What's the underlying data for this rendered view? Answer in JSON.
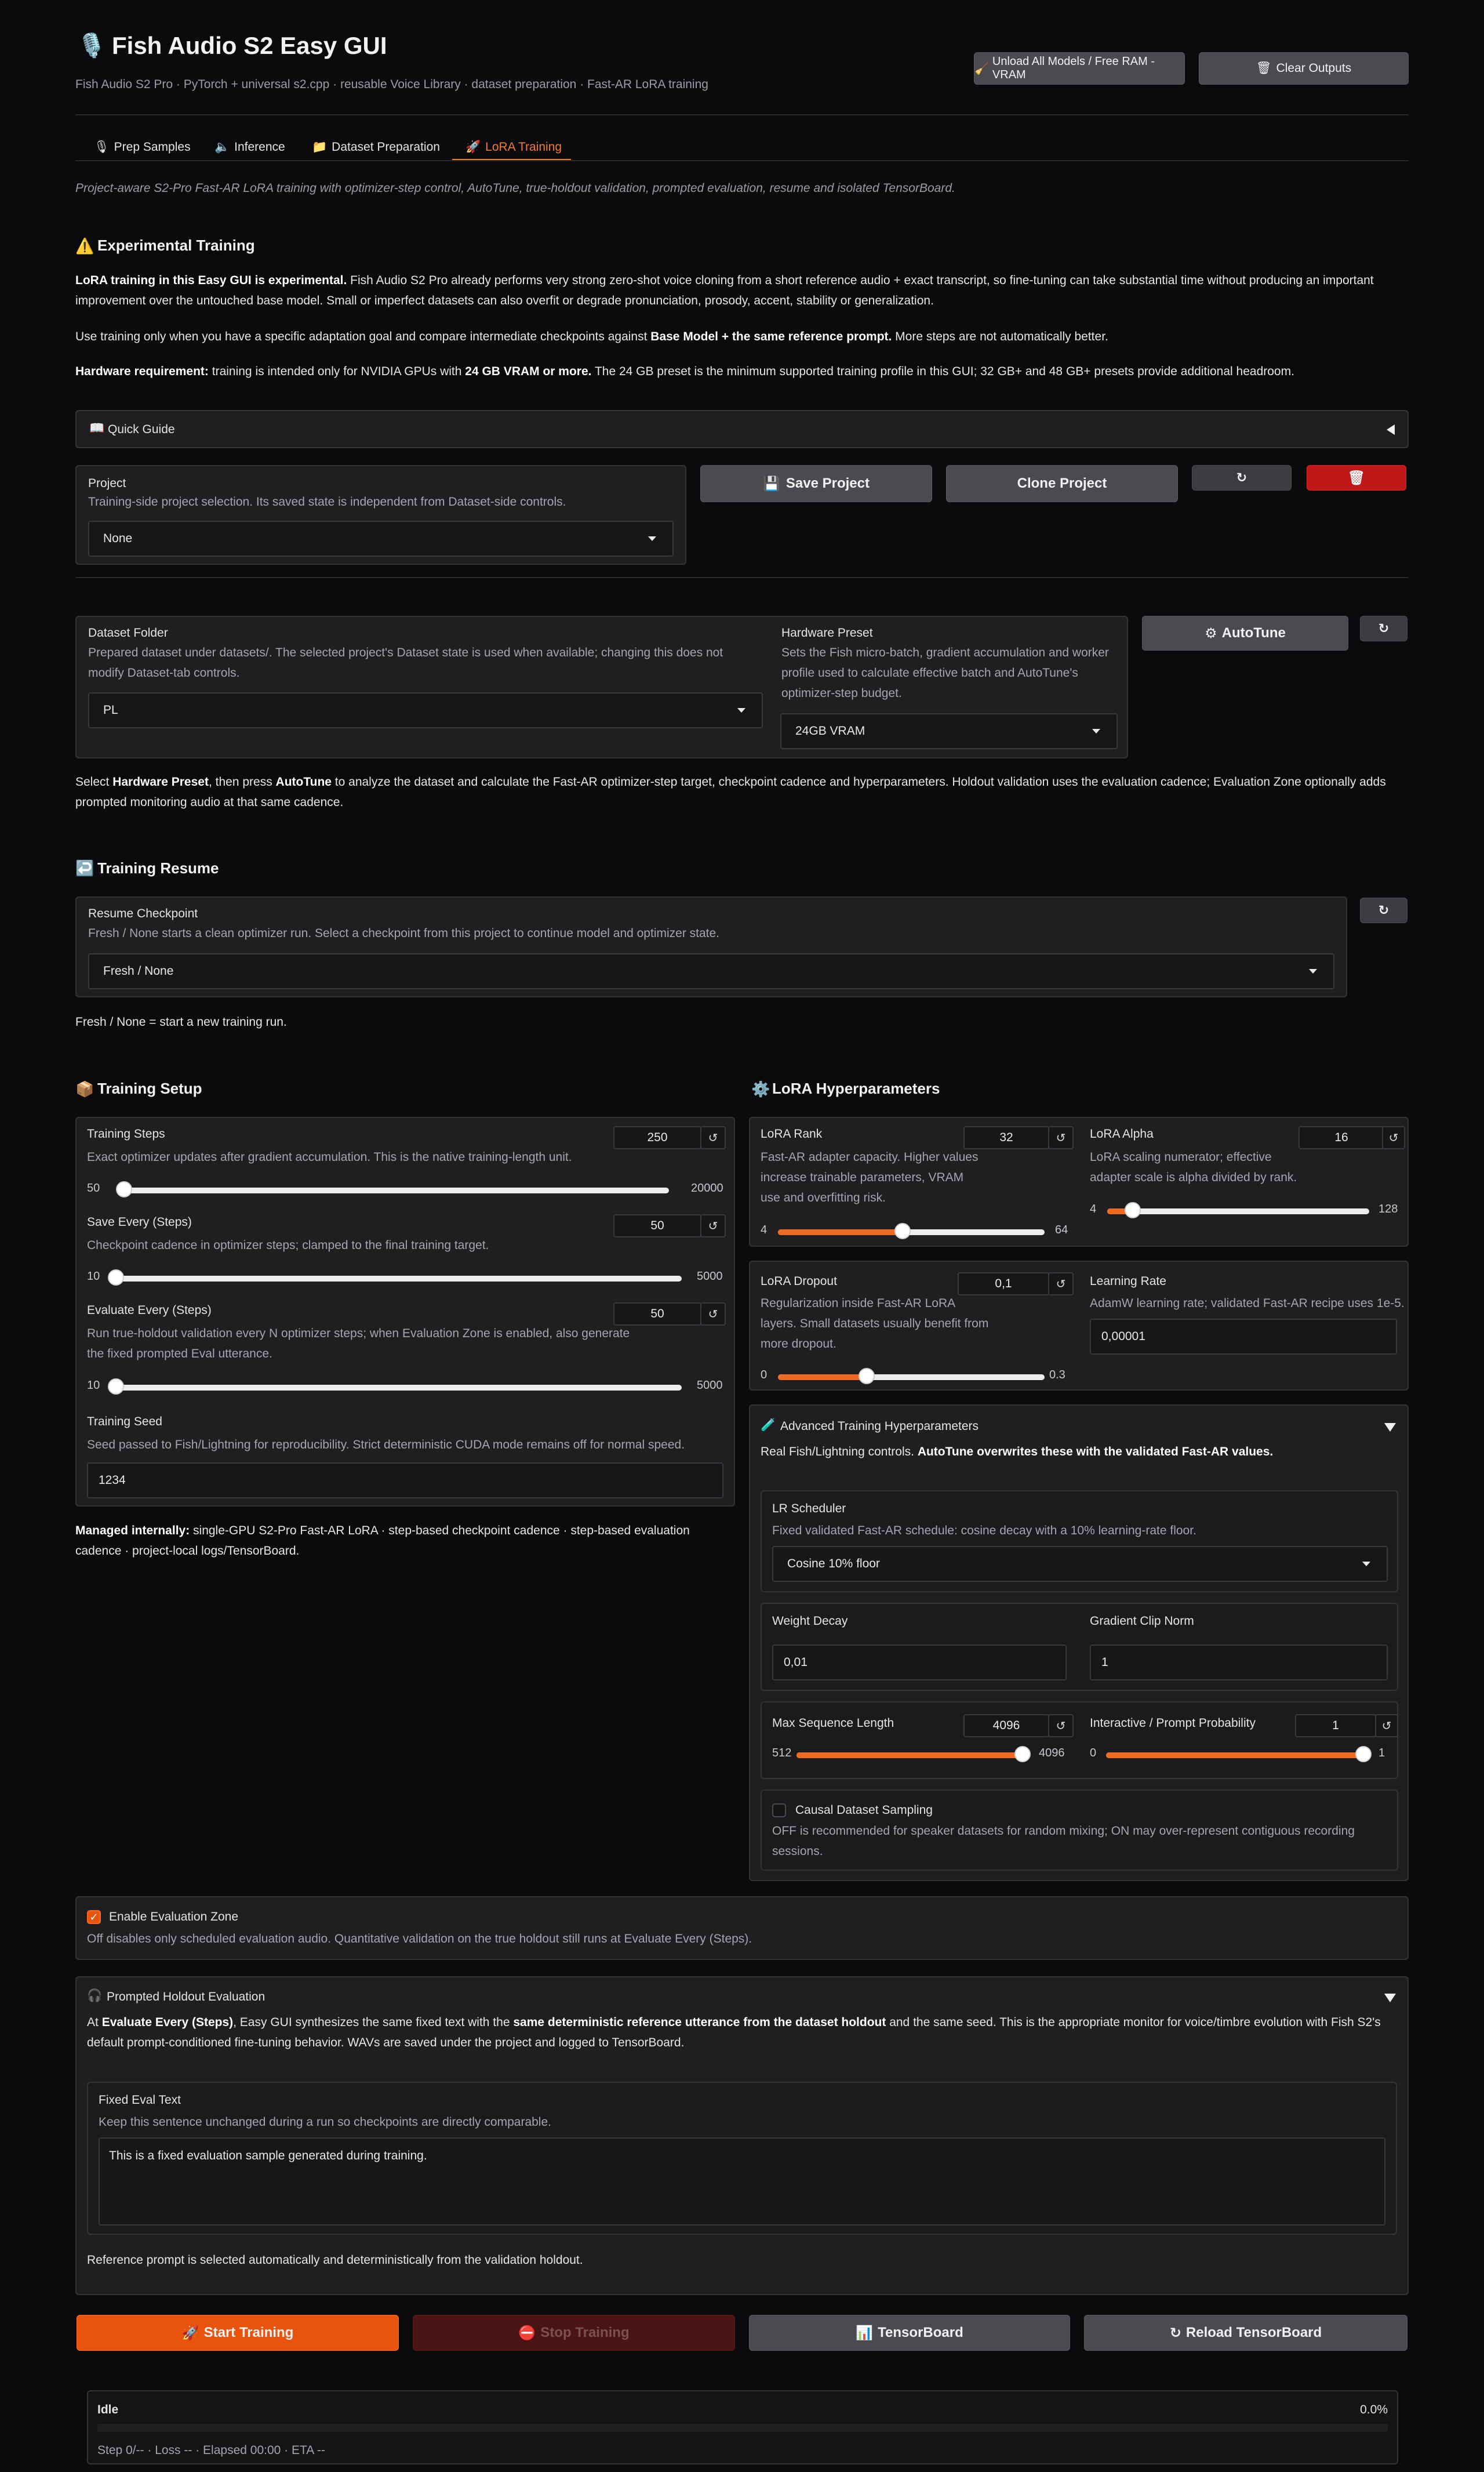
{
  "header": {
    "title": "Fish Audio S2 Easy GUI",
    "subtitle": "Fish Audio S2 Pro · PyTorch + universal s2.cpp · reusable Voice Library · dataset preparation · Fast-AR LoRA training",
    "unload_button": "Unload All Models / Free RAM - VRAM",
    "clear_button": "Clear Outputs"
  },
  "tabs": [
    {
      "label": "Prep Samples",
      "icon": "microphone-icon"
    },
    {
      "label": "Inference",
      "icon": "speaker-icon"
    },
    {
      "label": "Dataset Preparation",
      "icon": "folder-icon"
    },
    {
      "label": "LoRA Training",
      "icon": "rocket-icon",
      "active": true
    }
  ],
  "intro": "Project-aware S2-Pro Fast-AR LoRA training with optimizer-step control, AutoTune, true-holdout validation, prompted evaluation, resume and isolated TensorBoard.",
  "experimental": {
    "title": "Experimental Training",
    "p1_bold": "LoRA training in this Easy GUI is experimental.",
    "p1_rest": " Fish Audio S2 Pro already performs very strong zero-shot voice cloning from a short reference audio + exact transcript, so fine-tuning can take substantial time without producing an important improvement over the untouched base model. Small or imperfect datasets can also overfit or degrade pronunciation, prosody, accent, stability or generalization.",
    "p2_a": "Use training only when you have a specific adaptation goal and compare intermediate checkpoints against ",
    "p2_bold": "Base Model + the same reference prompt.",
    "p2_b": " More steps are not automatically better.",
    "p3_bold1": "Hardware requirement:",
    "p3_a": " training is intended only for NVIDIA GPUs with ",
    "p3_bold2": "24 GB VRAM or more.",
    "p3_b": " The 24 GB preset is the minimum supported training profile in this GUI; 32 GB+ and 48 GB+ presets provide additional headroom."
  },
  "quick_guide": {
    "label": "Quick Guide"
  },
  "project": {
    "label": "Project",
    "desc": "Training-side project selection. Its saved state is independent from Dataset-side controls.",
    "value": "None",
    "save_button": "Save Project",
    "clone_button": "Clone Project",
    "refresh_icon": "↻",
    "delete_icon": "trash-icon"
  },
  "dataset_folder": {
    "label": "Dataset Folder",
    "desc": "Prepared dataset under datasets/. The selected project's Dataset state is used when available; changing this does not modify Dataset-tab controls.",
    "value": "PL"
  },
  "hardware_preset": {
    "label": "Hardware Preset",
    "desc": "Sets the Fish micro-batch, gradient accumulation and worker profile used to calculate effective batch and AutoTune's optimizer-step budget.",
    "value": "24GB VRAM"
  },
  "autotune": {
    "label": "AutoTune",
    "refresh": "↻"
  },
  "autotune_note": {
    "a": "Select ",
    "b1": "Hardware Preset",
    "c": ", then press ",
    "b2": "AutoTune",
    "d": " to analyze the dataset and calculate the Fast-AR optimizer-step target, checkpoint cadence and hyperparameters. Holdout validation uses the evaluation cadence; Evaluation Zone optionally adds prompted monitoring audio at that same cadence."
  },
  "resume": {
    "title": "Training Resume",
    "label": "Resume Checkpoint",
    "desc": "Fresh / None starts a clean optimizer run. Select a checkpoint from this project to continue model and optimizer state.",
    "value": "Fresh / None",
    "note": "Fresh / None = start a new training run.",
    "refresh": "↻"
  },
  "training_setup": {
    "title": "Training Setup",
    "steps": {
      "label": "Training Steps",
      "desc": "Exact optimizer updates after gradient accumulation. This is the native training-length unit.",
      "value": "250",
      "min": "50",
      "max": "20000",
      "fraction": 0.01
    },
    "save_every": {
      "label": "Save Every (Steps)",
      "desc": "Checkpoint cadence in optimizer steps; clamped to the final training target.",
      "value": "50",
      "min": "10",
      "max": "5000",
      "fraction": 0.008
    },
    "eval_every": {
      "label": "Evaluate Every (Steps)",
      "desc": "Run true-holdout validation every N optimizer steps; when Evaluation Zone is enabled, also generate the fixed prompted Eval utterance.",
      "value": "50",
      "min": "10",
      "max": "5000",
      "fraction": 0.008
    },
    "seed": {
      "label": "Training Seed",
      "desc": "Seed passed to Fish/Lightning for reproducibility. Strict deterministic CUDA mode remains off for normal speed.",
      "value": "1234"
    },
    "managed_bold": "Managed internally:",
    "managed_rest": " single-GPU S2-Pro Fast-AR LoRA · step-based checkpoint cadence · step-based evaluation cadence · project-local logs/TensorBoard.",
    "reset_icon": "↺"
  },
  "lora": {
    "title": "LoRA Hyperparameters",
    "rank": {
      "label": "LoRA Rank",
      "desc": "Fast-AR adapter capacity. Higher values increase trainable parameters, VRAM use and overfitting risk.",
      "value": "32",
      "min": "4",
      "max": "64",
      "fraction": 0.467
    },
    "alpha": {
      "label": "LoRA Alpha",
      "desc": "LoRA scaling numerator; effective adapter scale is alpha divided by rank.",
      "value": "16",
      "min": "4",
      "max": "128",
      "fraction": 0.097
    },
    "dropout": {
      "label": "LoRA Dropout",
      "desc": "Regularization inside Fast-AR LoRA layers. Small datasets usually benefit from more dropout.",
      "value": "0,1",
      "min": "0",
      "max": "0.3",
      "fraction": 0.333
    },
    "lr": {
      "label": "Learning Rate",
      "desc": "AdamW learning rate; validated Fast-AR recipe uses 1e-5.",
      "value": "0,00001"
    }
  },
  "advanced": {
    "title": "Advanced Training Hyperparameters",
    "note_a": "Real Fish/Lightning controls. ",
    "note_bold": "AutoTune overwrites these with the validated Fast-AR values.",
    "scheduler": {
      "label": "LR Scheduler",
      "desc": "Fixed validated Fast-AR schedule: cosine decay with a 10% learning-rate floor.",
      "value": "Cosine 10% floor"
    },
    "weight_decay": {
      "label": "Weight Decay",
      "value": "0,01"
    },
    "clip": {
      "label": "Gradient Clip Norm",
      "value": "1"
    },
    "max_seq": {
      "label": "Max Sequence Length",
      "value": "4096",
      "min": "512",
      "max": "4096",
      "fraction": 1.0
    },
    "interactive": {
      "label": "Interactive / Prompt Probability",
      "value": "1",
      "min": "0",
      "max": "1",
      "fraction": 1.0
    },
    "causal": {
      "label": "Causal Dataset Sampling",
      "desc": "OFF is recommended for speaker datasets for random mixing; ON may over-represent contiguous recording sessions.",
      "checked": false
    }
  },
  "eval_zone": {
    "label": "Enable Evaluation Zone",
    "desc": "Off disables only scheduled evaluation audio. Quantitative validation on the true holdout still runs at Evaluate Every (Steps).",
    "checked": true
  },
  "prompted": {
    "title": "Prompted Holdout Evaluation",
    "a": "At ",
    "b1": "Evaluate Every (Steps)",
    "c": ", Easy GUI synthesizes the same fixed text with the ",
    "b2": "same deterministic reference utterance from the dataset holdout",
    "d": " and the same seed. This is the appropriate monitor for voice/timbre evolution with Fish S2's default prompt-conditioned fine-tuning behavior. WAVs are saved under the project and logged to TensorBoard.",
    "fixed_label": "Fixed Eval Text",
    "fixed_desc": "Keep this sentence unchanged during a run so checkpoints are directly comparable.",
    "fixed_value": "This is a fixed evaluation sample generated during training.",
    "ref_note": "Reference prompt is selected automatically and deterministically from the validation holdout."
  },
  "actions": {
    "start": "Start Training",
    "stop": "Stop Training",
    "tensorboard": "TensorBoard",
    "reload": "Reload TensorBoard"
  },
  "status": {
    "state": "Idle",
    "percent": "0.0%",
    "progress": 0.0,
    "line": "Step 0/-- · Loss -- · Elapsed 00:00 · ETA --"
  },
  "colors": {
    "accent": "#e8540e",
    "danger": "#c01818",
    "background": "#0b0b0d"
  }
}
